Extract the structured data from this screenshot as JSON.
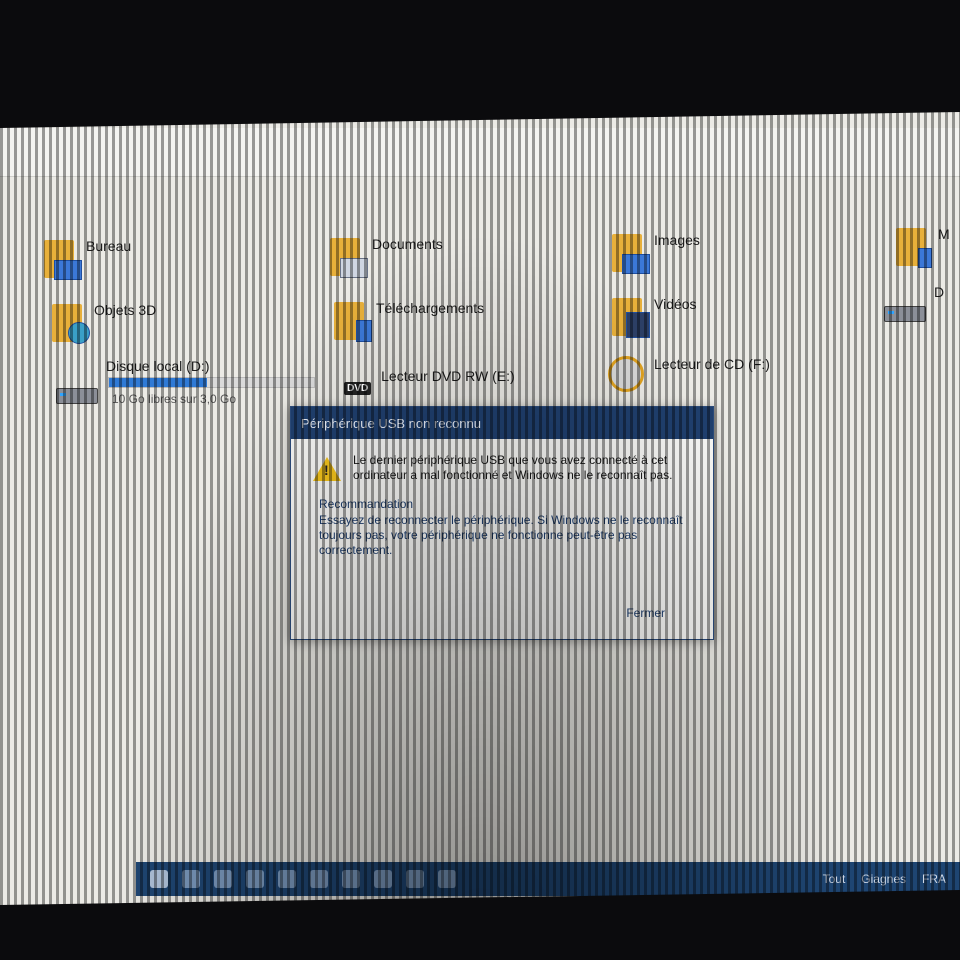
{
  "explorer": {
    "folders": [
      {
        "label": "Bureau",
        "icon": "desktop-folder-icon"
      },
      {
        "label": "Documents",
        "icon": "documents-folder-icon"
      },
      {
        "label": "Images",
        "icon": "pictures-folder-icon"
      },
      {
        "label": "M",
        "icon": "music-folder-icon"
      },
      {
        "label": "Objets 3D",
        "icon": "3d-objects-folder-icon"
      },
      {
        "label": "Téléchargements",
        "icon": "downloads-folder-icon"
      },
      {
        "label": "Vidéos",
        "icon": "videos-folder-icon"
      }
    ],
    "drives": [
      {
        "label": "Disque local (D:)",
        "sub": "10 Go libres sur 3,0 Go",
        "usage_fraction": 0.48,
        "icon": "hard-drive-icon"
      },
      {
        "label": "Lecteur DVD RW (E:)",
        "icon": "dvd-drive-icon",
        "badge": "DVD"
      },
      {
        "label": "Lecteur de CD (F:)",
        "icon": "cd-drive-icon"
      },
      {
        "label": "D",
        "icon": "drive-icon"
      }
    ]
  },
  "dialog": {
    "title": "Périphérique USB non reconnu",
    "message": "Le dernier périphérique USB que vous avez connecté à cet ordinateur a mal fonctionné et Windows ne le reconnaît pas.",
    "rec_heading": "Recommandation",
    "recommendation": "Essayez de reconnecter le périphérique. Si Windows ne le reconnaît toujours pas, votre périphérique ne fonctionne peut-être pas correctement.",
    "close_label": "Fermer",
    "icon": "warning-icon"
  },
  "taskbar": {
    "tray": [
      "Tout",
      "Giagnes",
      "FRA"
    ]
  },
  "colors": {
    "accent": "#1f3f6e",
    "folder": "#e8b03a",
    "drive_bar": "#2f7ad6",
    "warning": "#f2c21b"
  }
}
